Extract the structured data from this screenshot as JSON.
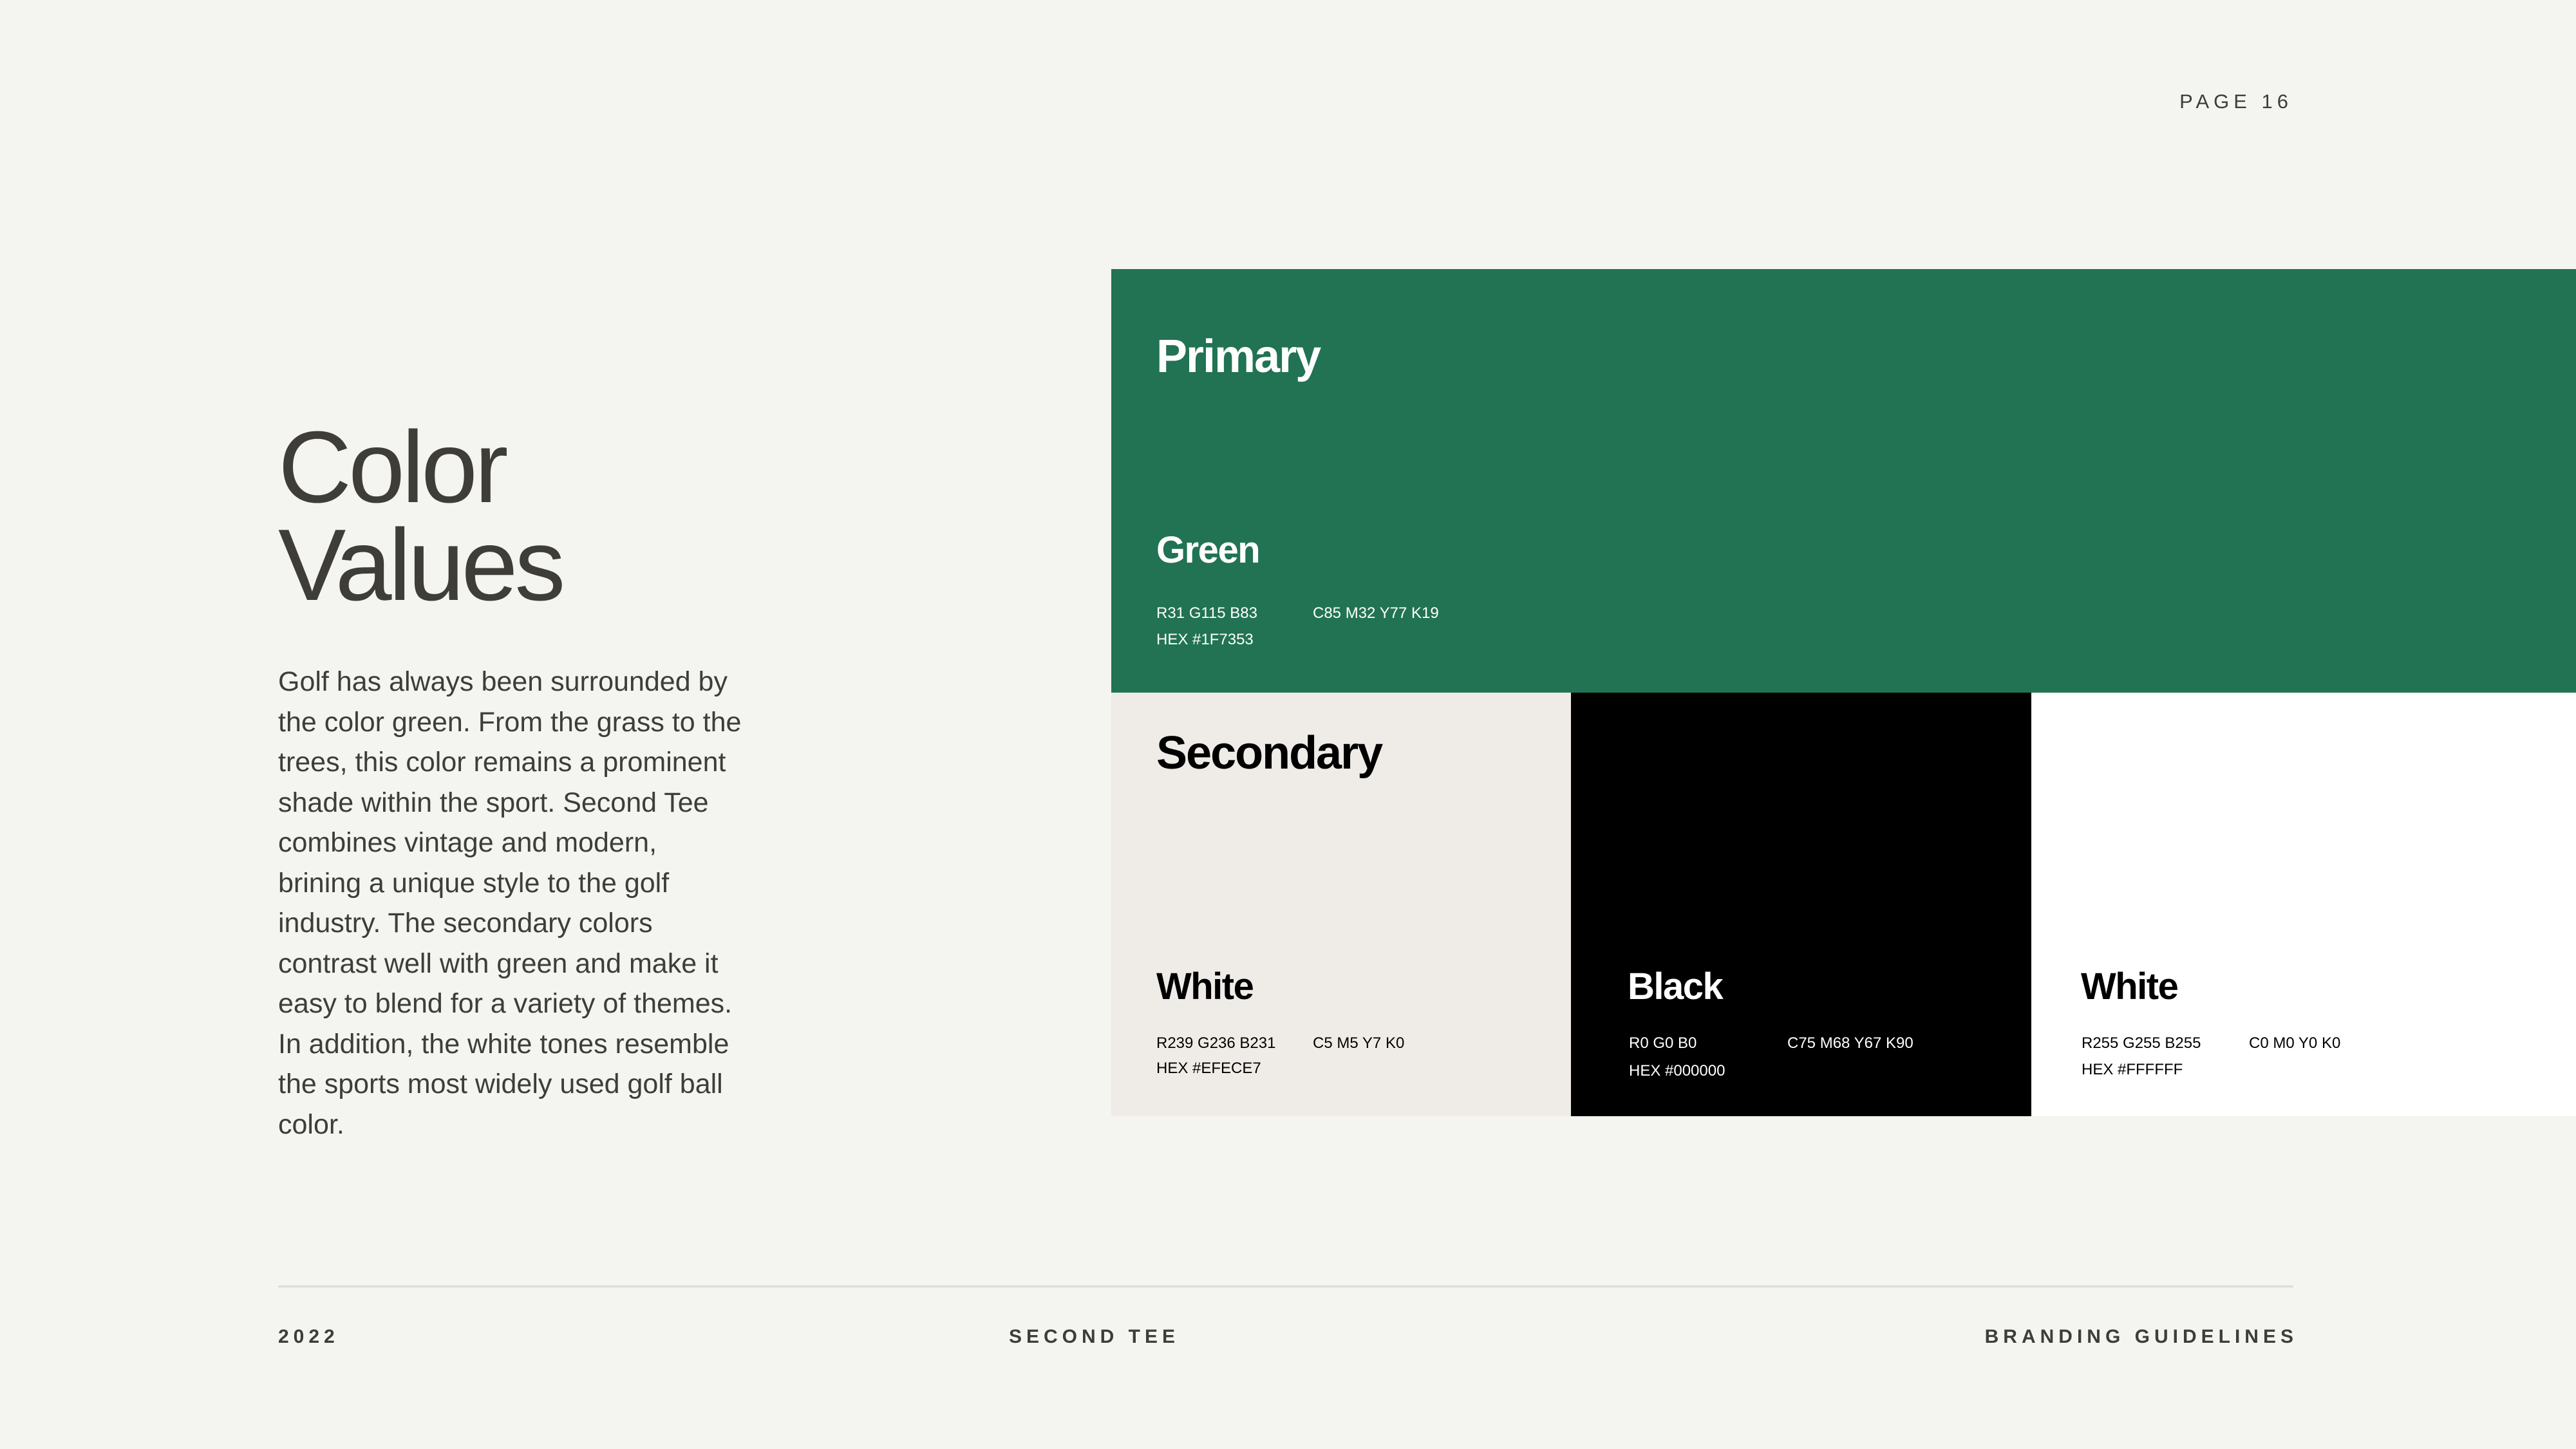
{
  "header": {
    "page_number": "PAGE 16"
  },
  "title": {
    "line1": "Color",
    "line2": "Values"
  },
  "description": "Golf has always been surrounded by the color green. From the grass to the trees, this color remains a prominent shade within the sport. Second Tee combines vintage and modern, brining a unique style to the golf industry. The secondary colors contrast well with green and make it easy to blend for a variety of themes. In addition, the white tones resemble the sports most widely used golf ball color.",
  "primary": {
    "label": "Primary",
    "name": "Green",
    "rgb": "R31 G115  B83",
    "cmyk": "C85 M32 Y77 K19",
    "hex": "HEX #1F7353",
    "color": "#1F7353"
  },
  "secondary": {
    "label": "Secondary",
    "colors": [
      {
        "name": "White",
        "rgb": "R239 G236 B231",
        "cmyk": "C5 M5 Y7 K0",
        "hex": "HEX #EFECE7",
        "color": "#EFECE7"
      },
      {
        "name": "Black",
        "rgb": "R0 G0 B0",
        "cmyk": "C75 M68 Y67 K90",
        "hex": "HEX #000000",
        "color": "#000000"
      },
      {
        "name": "White",
        "rgb": "R255 G255 B255",
        "cmyk": "C0 M0 Y0 K0",
        "hex": "HEX #FFFFFF",
        "color": "#FFFFFF"
      }
    ]
  },
  "footer": {
    "year": "2022",
    "brand": "SECOND TEE",
    "document": "BRANDING GUIDELINES"
  },
  "colors": {
    "background": "#F4F4F0",
    "text": "#3E3D38",
    "divider": "#DCDCD7"
  }
}
